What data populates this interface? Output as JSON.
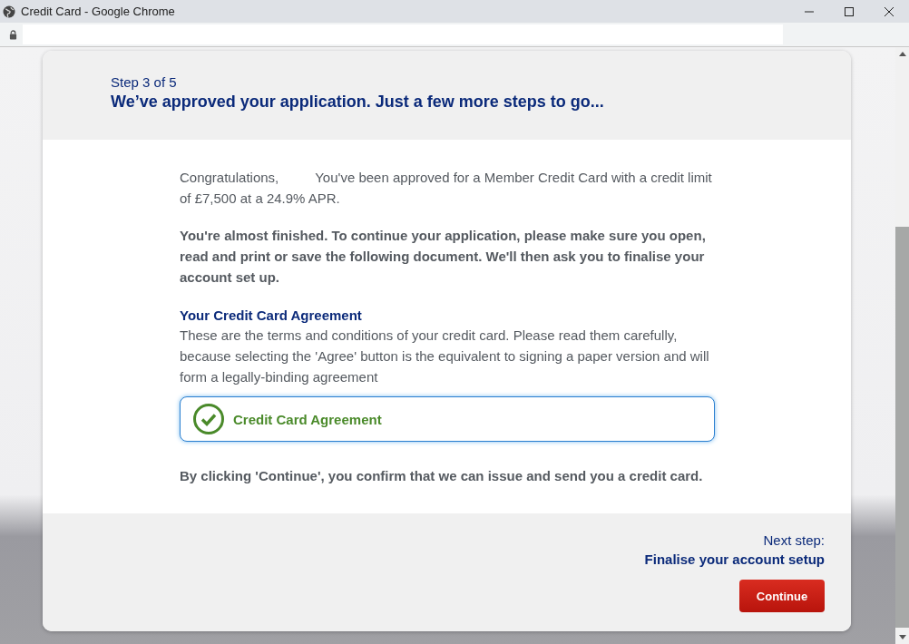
{
  "window": {
    "title": "Credit Card - Google Chrome"
  },
  "header": {
    "step": "Step 3 of 5",
    "heading": "We’ve approved your application. Just a few more steps to go..."
  },
  "intro": {
    "greeting": "Congratulations,",
    "message": "You've been approved for a Member Credit Card with a credit limit of £7,500 at a 24.9% APR."
  },
  "notice": "You're almost finished. To continue your application, please make sure you open, read and print or save the following document. We'll then ask you to finalise your account set up.",
  "agreement_section": {
    "title": "Your Credit Card Agreement",
    "text": "These are the terms and conditions of your credit card. Please read them carefully, because selecting the 'Agree' button is the equivalent to signing a paper version and will form a legally-binding agreement",
    "documents": [
      {
        "label": "Credit Card Agreement",
        "checked": true
      }
    ]
  },
  "confirmation": "By clicking 'Continue', you confirm that we can issue and send you a credit card.",
  "footer": {
    "next_label": "Next step:",
    "next_title": "Finalise your account setup",
    "button": "Continue"
  }
}
